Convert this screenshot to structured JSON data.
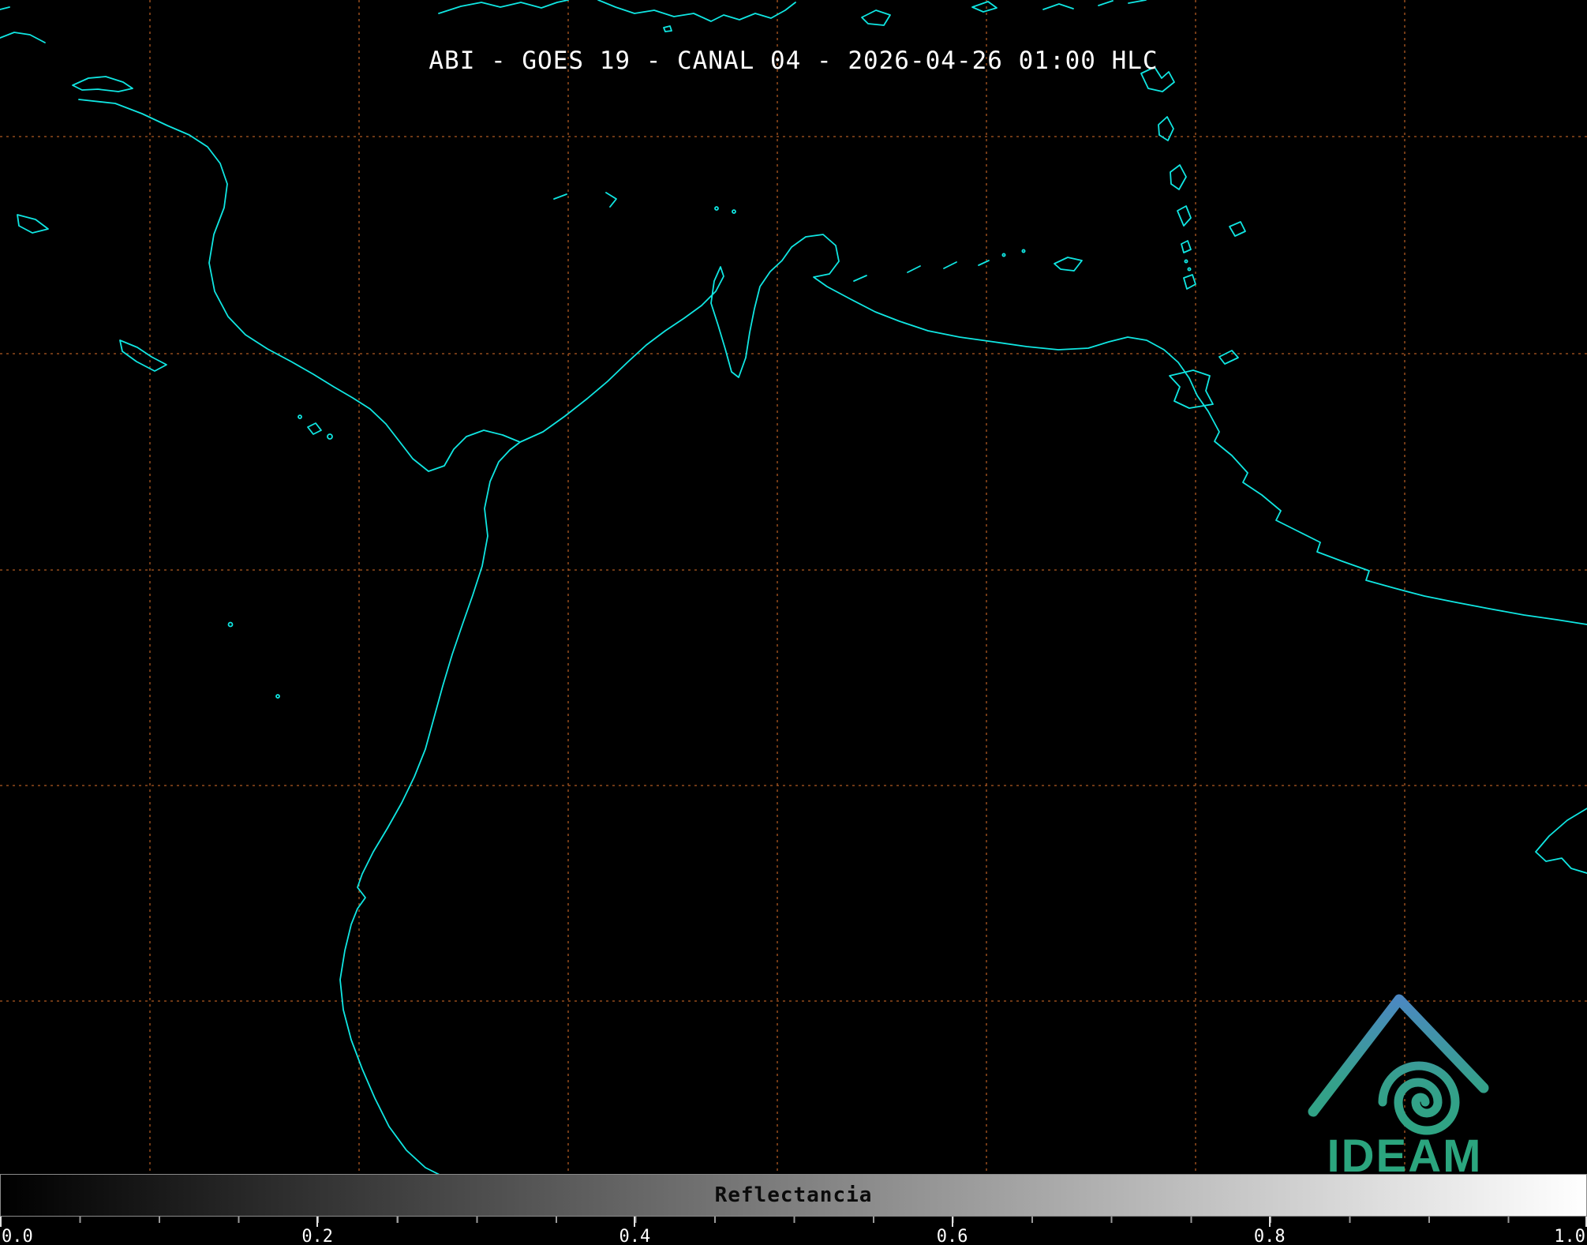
{
  "title": "ABI - GOES 19 - CANAL 04 - 2026-04-26 01:00 HLC",
  "map": {
    "background_color": "#000000",
    "coastline_color": "#10e6e2",
    "grid_color": "#b05a22"
  },
  "colorbar": {
    "label": "Reflectancia",
    "ticks": [
      "0.0",
      "0.2",
      "0.4",
      "0.6",
      "0.8",
      "1.0"
    ],
    "min": "0.0",
    "max": "1.0",
    "gradient_start_color": "#000000",
    "gradient_end_color": "#ffffff"
  },
  "logo": {
    "text": "IDEAM",
    "color_top": "#4d86c6",
    "color_bottom": "#2ba57e"
  }
}
